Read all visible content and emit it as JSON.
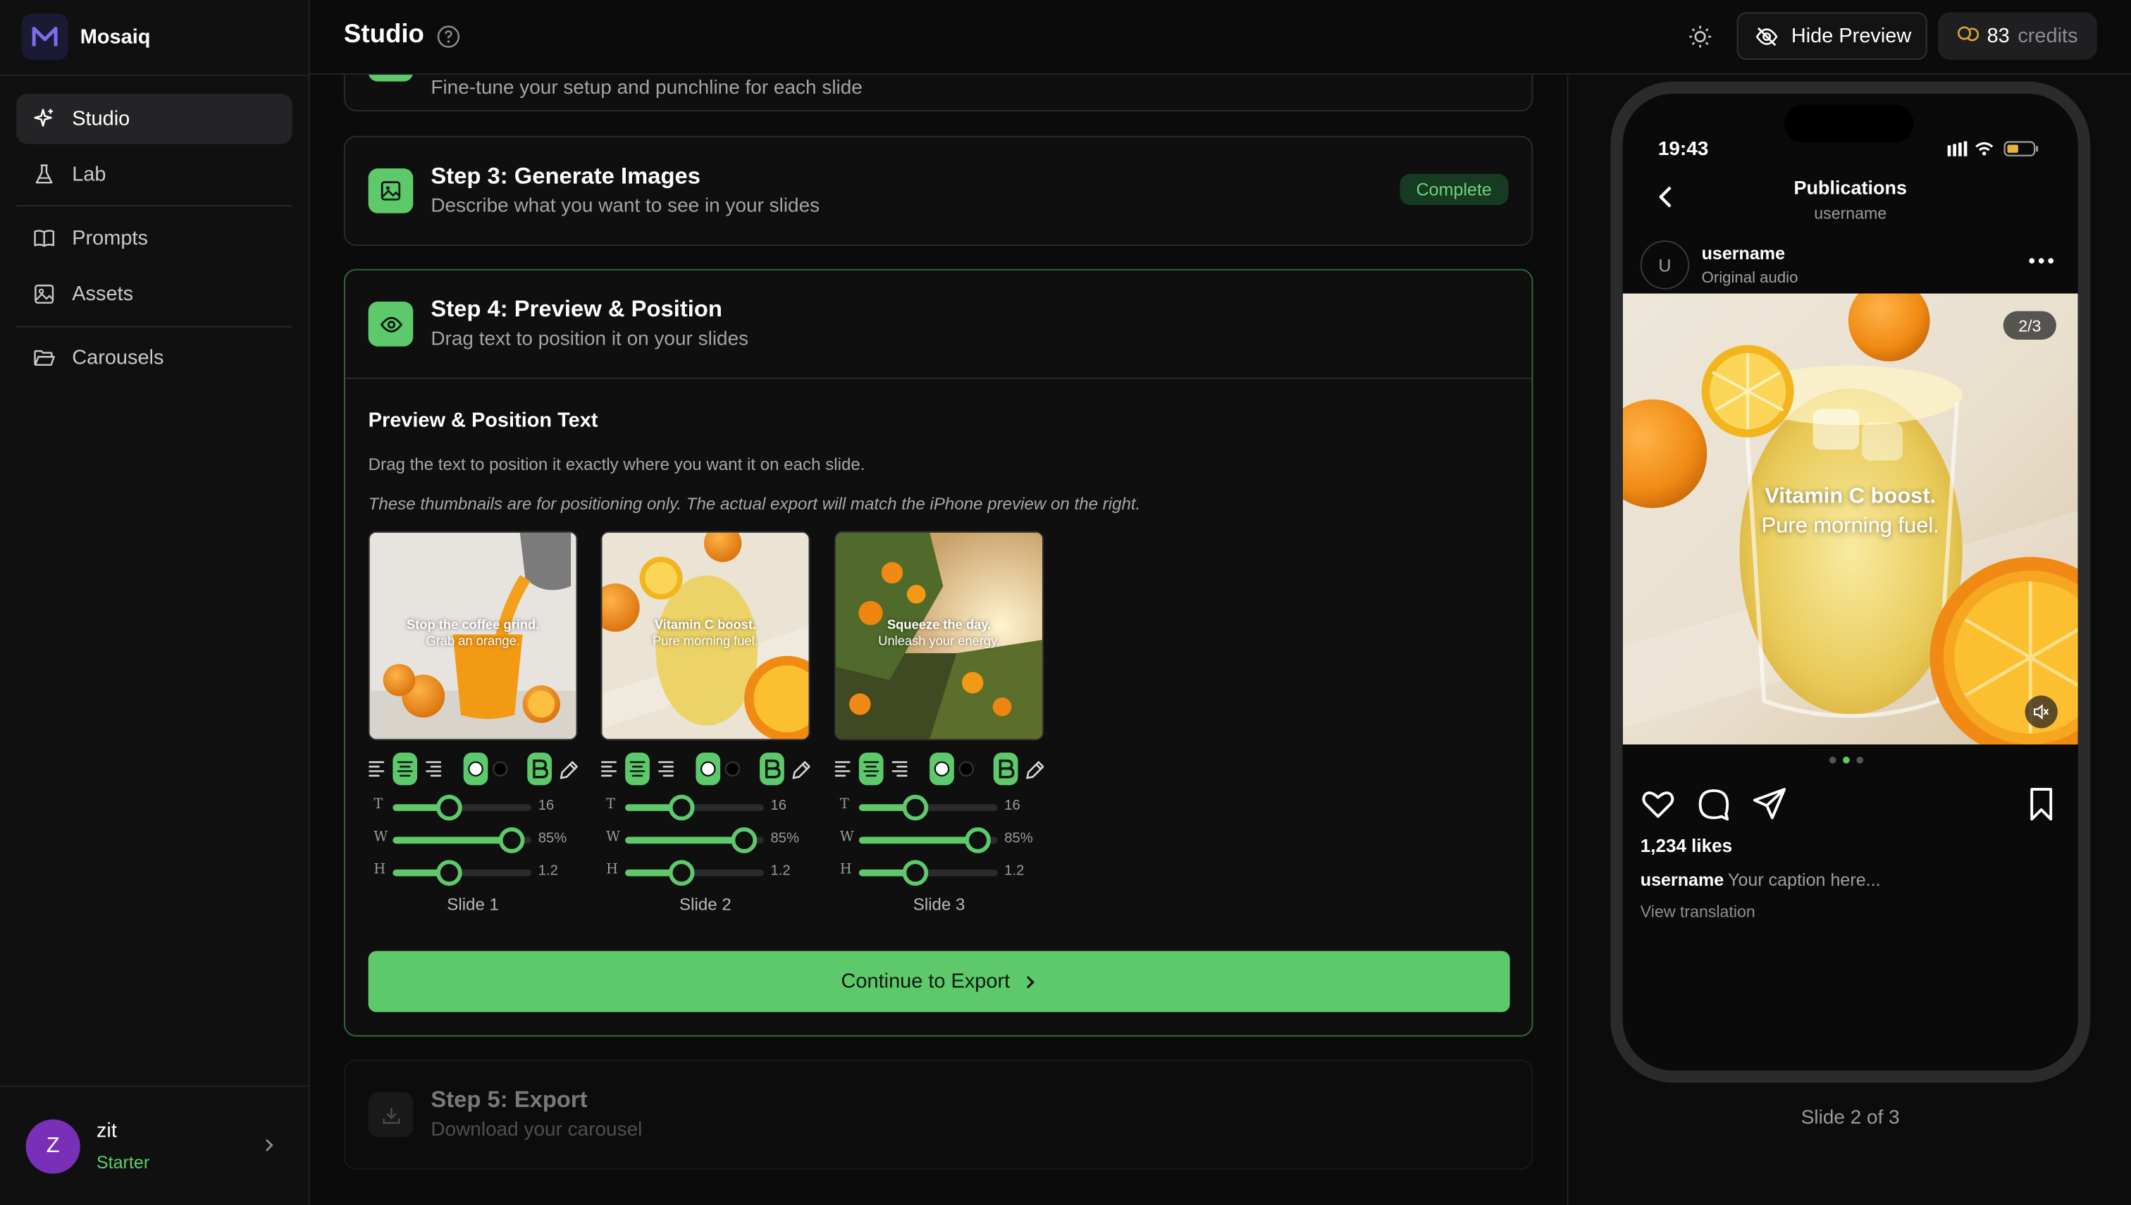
{
  "app": {
    "name": "Mosaiq",
    "logo_letter": "M"
  },
  "sidebar": {
    "items": [
      {
        "label": "Studio",
        "icon": "sparkles-icon",
        "active": true
      },
      {
        "label": "Lab",
        "icon": "flask-icon"
      },
      {
        "label": "Prompts",
        "icon": "book-icon"
      },
      {
        "label": "Assets",
        "icon": "image-icon"
      },
      {
        "label": "Carousels",
        "icon": "folder-icon"
      }
    ],
    "user": {
      "initial": "Z",
      "name": "zit",
      "plan": "Starter"
    }
  },
  "header": {
    "title": "Studio",
    "hide_preview_label": "Hide Preview",
    "credits_count": "83",
    "credits_label": "credits"
  },
  "steps": {
    "step2": {
      "desc": "Fine-tune your setup and punchline for each slide"
    },
    "step3": {
      "title": "Step 3: Generate Images",
      "desc": "Describe what you want to see in your slides",
      "badge": "Complete"
    },
    "step4": {
      "title": "Step 4: Preview & Position",
      "desc": "Drag text to position it on your slides",
      "heading": "Preview & Position Text",
      "subtext": "Drag the text to position it exactly where you want it on each slide.",
      "note": "These thumbnails are for positioning only. The actual export will match the iPhone preview on the right.",
      "continue_label": "Continue to Export"
    },
    "step5": {
      "title": "Step 5: Export",
      "desc": "Download your carousel"
    }
  },
  "slides": [
    {
      "label": "Slide 1",
      "line1": "Stop the coffee grind.",
      "line2": "Grab an orange.",
      "size": "16",
      "width": "85%",
      "height": "1.2",
      "size_level": 0.4,
      "width_level": 0.85,
      "height_level": 0.4
    },
    {
      "label": "Slide 2",
      "line1": "Vitamin C boost.",
      "line2": "Pure morning fuel.",
      "size": "16",
      "width": "85%",
      "height": "1.2",
      "size_level": 0.4,
      "width_level": 0.85,
      "height_level": 0.4
    },
    {
      "label": "Slide 3",
      "line1": "Squeeze the day.",
      "line2": "Unleash your energy.",
      "size": "16",
      "width": "85%",
      "height": "1.2",
      "size_level": 0.4,
      "width_level": 0.85,
      "height_level": 0.4
    }
  ],
  "phone": {
    "time": "19:43",
    "title": "Publications",
    "subtitle": "username",
    "avatar_initial": "U",
    "username": "username",
    "audio": "Original audio",
    "counter": "2/3",
    "overlay_line1": "Vitamin C boost.",
    "overlay_line2": "Pure morning fuel.",
    "likes": "1,234 likes",
    "caption_user": "username",
    "caption_text": "Your caption here...",
    "view_translation": "View translation",
    "slide_status": "Slide 2 of 3"
  },
  "colors": {
    "accent": "#5dc96b",
    "avatar": "#7a2fb8",
    "badge_bg": "#173a22"
  }
}
